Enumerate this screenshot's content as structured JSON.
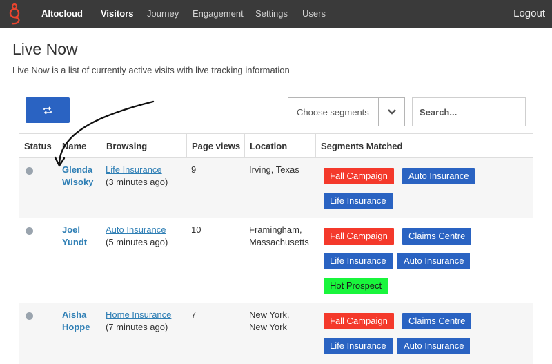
{
  "nav": {
    "brand": "Altocloud",
    "items": [
      "Visitors",
      "Journey",
      "Engagement",
      "Settings",
      "Users"
    ],
    "active": "Visitors",
    "logout": "Logout"
  },
  "page": {
    "title": "Live Now",
    "description": "Live Now is a list of currently active visits with live tracking information"
  },
  "controls": {
    "segments_placeholder": "Choose segments",
    "search_placeholder": "Search..."
  },
  "table": {
    "headers": [
      "Status",
      "Name",
      "Browsing",
      "Page views",
      "Location",
      "Segments Matched"
    ],
    "rows": [
      {
        "first_name": "Glenda",
        "last_name": "Wisoky",
        "page": "Life Insurance",
        "time": "(3 minutes ago)",
        "views": "9",
        "location_1": "Irving, Texas",
        "location_2": "",
        "segments": [
          {
            "label": "Fall Campaign",
            "color": "red"
          },
          {
            "label": "Auto Insurance",
            "color": "blue"
          },
          {
            "label": "Life Insurance",
            "color": "blue"
          }
        ]
      },
      {
        "first_name": "Joel",
        "last_name": "Yundt",
        "page": "Auto Insurance",
        "time": "(5 minutes ago)",
        "views": "10",
        "location_1": "Framingham,",
        "location_2": "Massachusetts",
        "segments": [
          {
            "label": "Fall Campaign",
            "color": "red"
          },
          {
            "label": "Claims Centre",
            "color": "blue"
          },
          {
            "label": "Life Insurance",
            "color": "blue"
          },
          {
            "label": "Auto Insurance",
            "color": "blue"
          },
          {
            "label": "Hot Prospect",
            "color": "green"
          }
        ]
      },
      {
        "first_name": "Aisha",
        "last_name": "Hoppe",
        "page": "Home Insurance",
        "time": "(7 minutes ago)",
        "views": "7",
        "location_1": "New York,",
        "location_2": "New York",
        "segments": [
          {
            "label": "Fall Campaign",
            "color": "red"
          },
          {
            "label": "Claims Centre",
            "color": "blue"
          },
          {
            "label": "Life Insurance",
            "color": "blue"
          },
          {
            "label": "Auto Insurance",
            "color": "blue"
          }
        ]
      }
    ]
  },
  "colors": {
    "nav_bg": "#3a3a3a",
    "primary": "#2a63c2",
    "danger": "#f4392b",
    "success": "#19f53c",
    "link": "#2f7fb5",
    "logo": "#e8442e"
  }
}
